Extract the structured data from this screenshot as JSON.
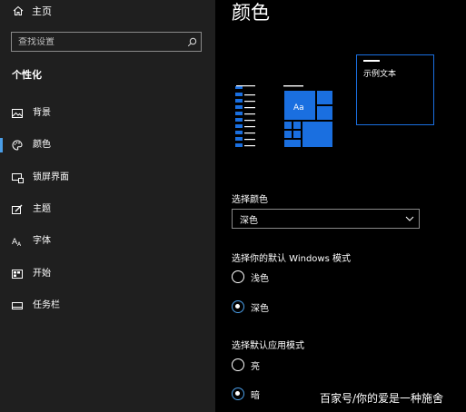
{
  "sidebar": {
    "home_label": "主页",
    "search_placeholder": "查找设置",
    "section_title": "个性化",
    "items": [
      {
        "label": "背景",
        "icon": "picture-icon"
      },
      {
        "label": "颜色",
        "icon": "palette-icon",
        "active": true
      },
      {
        "label": "锁屏界面",
        "icon": "lock-screen-icon"
      },
      {
        "label": "主题",
        "icon": "brush-icon"
      },
      {
        "label": "字体",
        "icon": "font-icon"
      },
      {
        "label": "开始",
        "icon": "start-icon"
      },
      {
        "label": "任务栏",
        "icon": "taskbar-icon"
      }
    ]
  },
  "main": {
    "title": "颜色",
    "preview": {
      "sample_text": "示例文本",
      "tile_text": "Aa"
    },
    "choose_color": {
      "label": "选择颜色",
      "selected": "深色"
    },
    "windows_mode": {
      "label": "选择你的默认 Windows 模式",
      "options": [
        {
          "label": "浅色",
          "selected": false
        },
        {
          "label": "深色",
          "selected": true
        }
      ]
    },
    "app_mode": {
      "label": "选择默认应用模式",
      "options": [
        {
          "label": "亮",
          "selected": false
        },
        {
          "label": "暗",
          "selected": true
        }
      ]
    }
  },
  "watermark": "百家号/你的爱是一种施舍",
  "colors": {
    "accent": "#1a6fe0",
    "sidebar_bg": "#1f1f1f",
    "main_bg": "#000000",
    "indicator": "#4a9ee8"
  }
}
